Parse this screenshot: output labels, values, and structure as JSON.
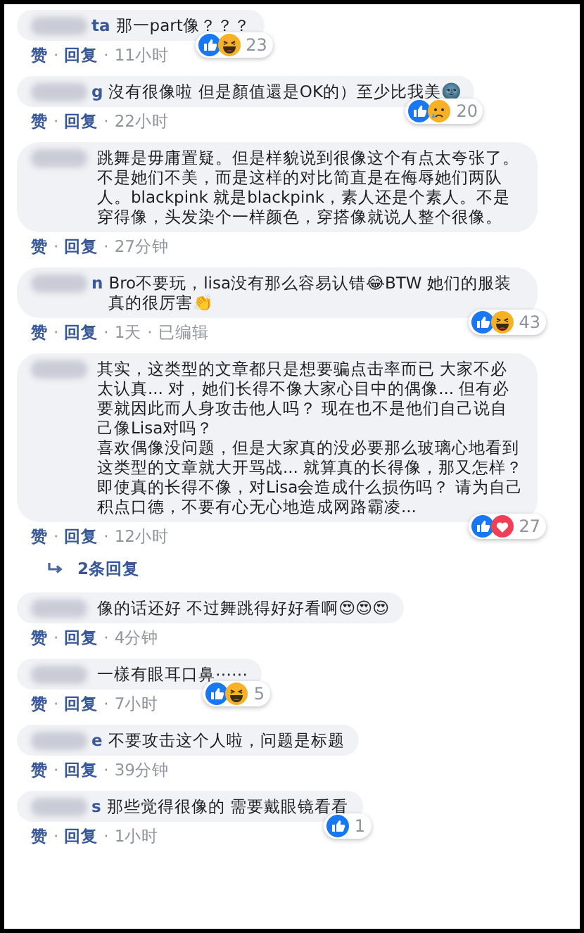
{
  "separator": "·",
  "comments": [
    {
      "name_fragment": "ta",
      "text": "那一part像？？？",
      "actions": [
        "赞",
        "回复"
      ],
      "meta": [
        "11小时"
      ],
      "reactions": {
        "icons": [
          {
            "kind": "like"
          },
          {
            "kind": "haha"
          }
        ],
        "count": "23"
      }
    },
    {
      "name_fragment": "g",
      "text": "沒有很像啦 但是顏值還是OK的）至少比我美🌚",
      "actions": [
        "赞",
        "回复"
      ],
      "meta": [
        "22小时"
      ],
      "reactions": {
        "icons": [
          {
            "kind": "like"
          },
          {
            "kind": "sad"
          }
        ],
        "count": "20"
      }
    },
    {
      "text": "跳舞是毋庸置疑。但是样貌说到很像这个有点太夸张了。不是她们不美，而是这样的对比简直是在侮辱她们两队人。blackpink 就是blackpink，素人还是个素人。不是穿得像，头发染个一样颜色，穿搭像就说人整个很像。",
      "actions": [
        "赞",
        "回复"
      ],
      "meta": [
        "27分钟"
      ]
    },
    {
      "name_fragment": "n",
      "text": "Bro不要玩，lisa没有那么容易认错😂BTW 她们的服装真的很厉害👏",
      "actions": [
        "赞",
        "回复"
      ],
      "meta": [
        "1天",
        "已编辑"
      ],
      "reactions": {
        "icons": [
          {
            "kind": "like"
          },
          {
            "kind": "haha"
          }
        ],
        "count": "43"
      }
    },
    {
      "paragraphs": [
        "其实，这类型的文章都只是想要骗点击率而已 大家不必太认真... 对，她们长得不像大家心目中的偶像... 但有必要就因此而人身攻击他人吗？ 现在也不是他们自己说自己像Lisa对吗？",
        "喜欢偶像没问题，但是大家真的没必要那么玻璃心地看到这类型的文章就大开骂战... 就算真的长得像，那又怎样？即使真的长得不像，对Lisa会造成什么损伤吗？ 请为自己积点口德，不要有心无心地造成网路霸凌..."
      ],
      "actions": [
        "赞",
        "回复"
      ],
      "meta": [
        "12小时"
      ],
      "reactions": {
        "icons": [
          {
            "kind": "like"
          },
          {
            "kind": "love"
          }
        ],
        "count": "27"
      },
      "replies_link": "2条回复"
    },
    {
      "text": "像的话还好 不过舞跳得好好看啊😍😍😍",
      "actions": [
        "赞",
        "回复"
      ],
      "meta": [
        "4分钟"
      ]
    },
    {
      "text": "一樣有眼耳口鼻⋯⋯",
      "actions": [
        "赞",
        "回复"
      ],
      "meta": [
        "7小时"
      ],
      "reactions": {
        "icons": [
          {
            "kind": "like"
          },
          {
            "kind": "haha"
          }
        ],
        "count": "5"
      }
    },
    {
      "name_fragment": "e",
      "text": "不要攻击这个人啦，问题是标题",
      "actions": [
        "赞",
        "回复"
      ],
      "meta": [
        "39分钟"
      ]
    },
    {
      "name_fragment": "s",
      "text": "那些觉得很像的 需要戴眼镜看看",
      "actions": [
        "赞",
        "回复"
      ],
      "meta": [
        "1小时"
      ],
      "reactions": {
        "icons": [
          {
            "kind": "like"
          }
        ],
        "count": "1"
      }
    }
  ]
}
